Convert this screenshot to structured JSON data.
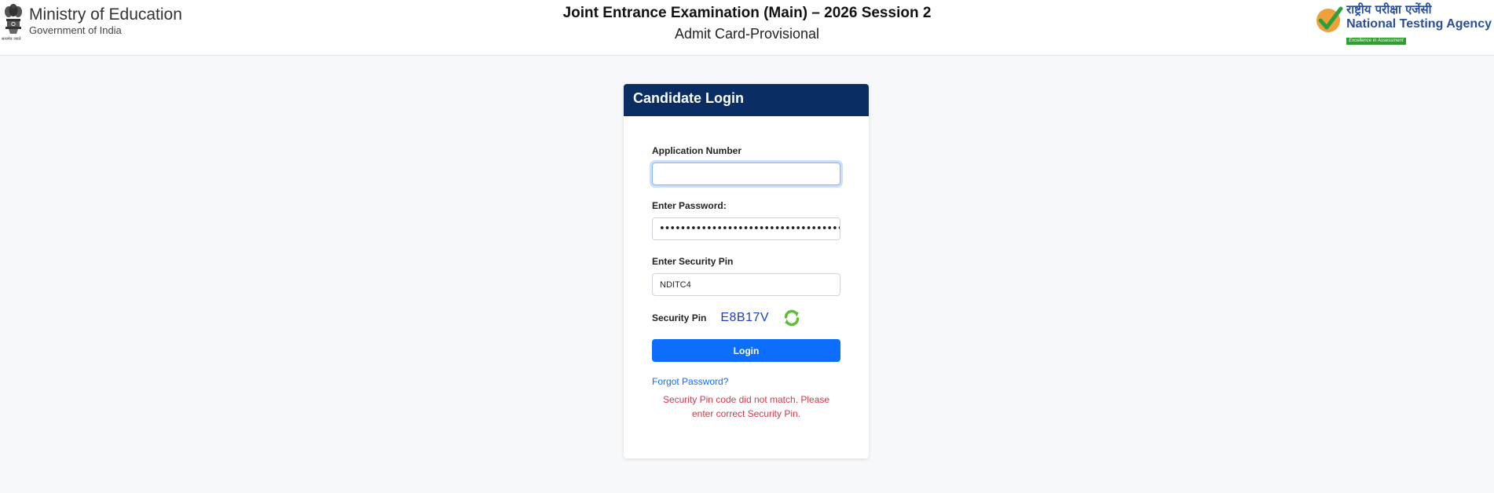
{
  "header": {
    "ministry_title": "Ministry of Education",
    "ministry_subtitle": "Government of India",
    "emblem_caption": "सत्यमेव जयते",
    "exam_title": "Joint Entrance Examination (Main) – 2026 Session 2",
    "page_subtitle": "Admit Card-Provisional",
    "nta_hindi": "राष्ट्रीय परीक्षा एजेंसी",
    "nta_name": "National Testing Agency",
    "nta_tagline": "Excellence in Assessment"
  },
  "login": {
    "title": "Candidate Login",
    "application_label": "Application Number",
    "application_value": "",
    "password_label": "Enter Password:",
    "password_masked": "••••••••••••••••••••••••••••••••••••••••••••••••••••",
    "security_pin_label": "Enter Security Pin",
    "security_pin_value": "NDITC4",
    "captcha_label": "Security Pin",
    "captcha_code": "E8B17V",
    "login_button": "Login",
    "forgot_link": "Forgot Password?",
    "error_message": "Security Pin code did not match. Please enter correct Security Pin."
  },
  "colors": {
    "header_navy": "#0a2e63",
    "primary_blue": "#0d6efd",
    "error_red": "#dc3545",
    "captcha_blue": "#1d3fb8",
    "refresh_green": "#5cc02e"
  },
  "icons": [
    "national-emblem-icon",
    "nta-logo-icon",
    "refresh-icon"
  ]
}
